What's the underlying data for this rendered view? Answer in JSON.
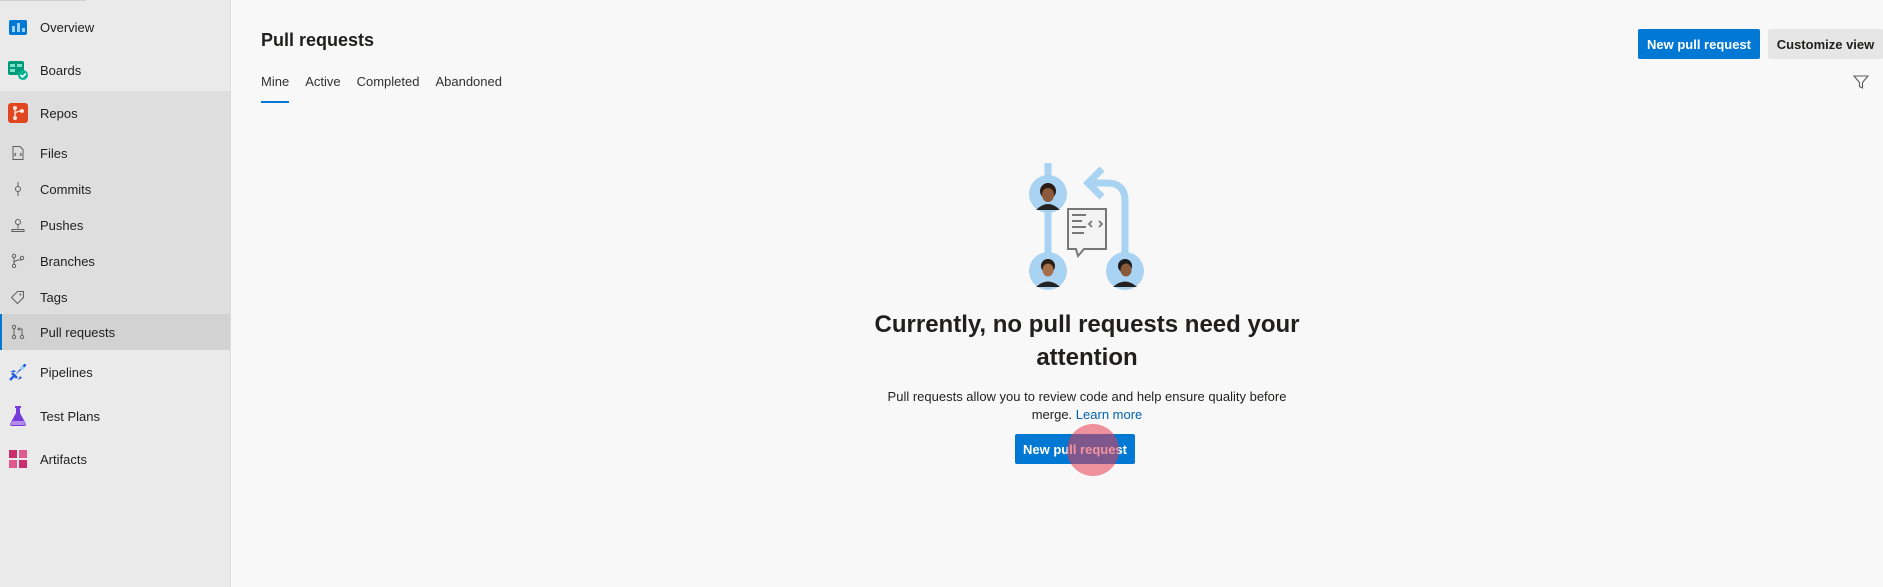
{
  "sidebar": {
    "items": [
      {
        "label": "Overview",
        "icon": "overview-icon"
      },
      {
        "label": "Boards",
        "icon": "boards-icon"
      },
      {
        "label": "Repos",
        "icon": "repos-icon"
      },
      {
        "label": "Files",
        "icon": "files-icon"
      },
      {
        "label": "Commits",
        "icon": "commits-icon"
      },
      {
        "label": "Pushes",
        "icon": "pushes-icon"
      },
      {
        "label": "Branches",
        "icon": "branches-icon"
      },
      {
        "label": "Tags",
        "icon": "tags-icon"
      },
      {
        "label": "Pull requests",
        "icon": "pull-requests-icon"
      },
      {
        "label": "Pipelines",
        "icon": "pipelines-icon"
      },
      {
        "label": "Test Plans",
        "icon": "test-plans-icon"
      },
      {
        "label": "Artifacts",
        "icon": "artifacts-icon"
      }
    ],
    "selected": "Pull requests"
  },
  "header": {
    "title": "Pull requests",
    "new_pr_label": "New pull request",
    "customize_label": "Customize view"
  },
  "tabs": [
    {
      "label": "Mine"
    },
    {
      "label": "Active"
    },
    {
      "label": "Completed"
    },
    {
      "label": "Abandoned"
    }
  ],
  "active_tab": "Mine",
  "empty_state": {
    "title": "Currently, no pull requests need your attention",
    "description": "Pull requests allow you to review code and help ensure quality before merge.",
    "learn_more": "Learn more",
    "button_label": "New pull request"
  },
  "colors": {
    "accent": "#0078d4",
    "link": "#0062ad"
  }
}
